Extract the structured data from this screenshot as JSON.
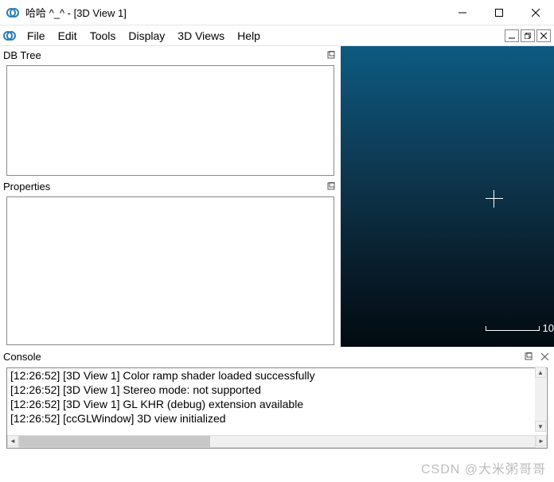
{
  "titlebar": {
    "title": "哈哈 ^_^  - [3D View 1]"
  },
  "menubar": {
    "items": [
      "File",
      "Edit",
      "Tools",
      "Display",
      "3D Views",
      "Help"
    ]
  },
  "panels": {
    "dbtree": {
      "title": "DB Tree"
    },
    "properties": {
      "title": "Properties"
    },
    "console": {
      "title": "Console"
    }
  },
  "viewport": {
    "scale_label": "10"
  },
  "console_lines": [
    "[12:26:52] [3D View 1] Color ramp shader loaded successfully",
    "[12:26:52] [3D View 1] Stereo mode: not supported",
    "[12:26:52] [3D View 1] GL KHR (debug) extension available",
    "[12:26:52] [ccGLWindow] 3D view initialized"
  ],
  "watermark": "CSDN @大米粥哥哥"
}
